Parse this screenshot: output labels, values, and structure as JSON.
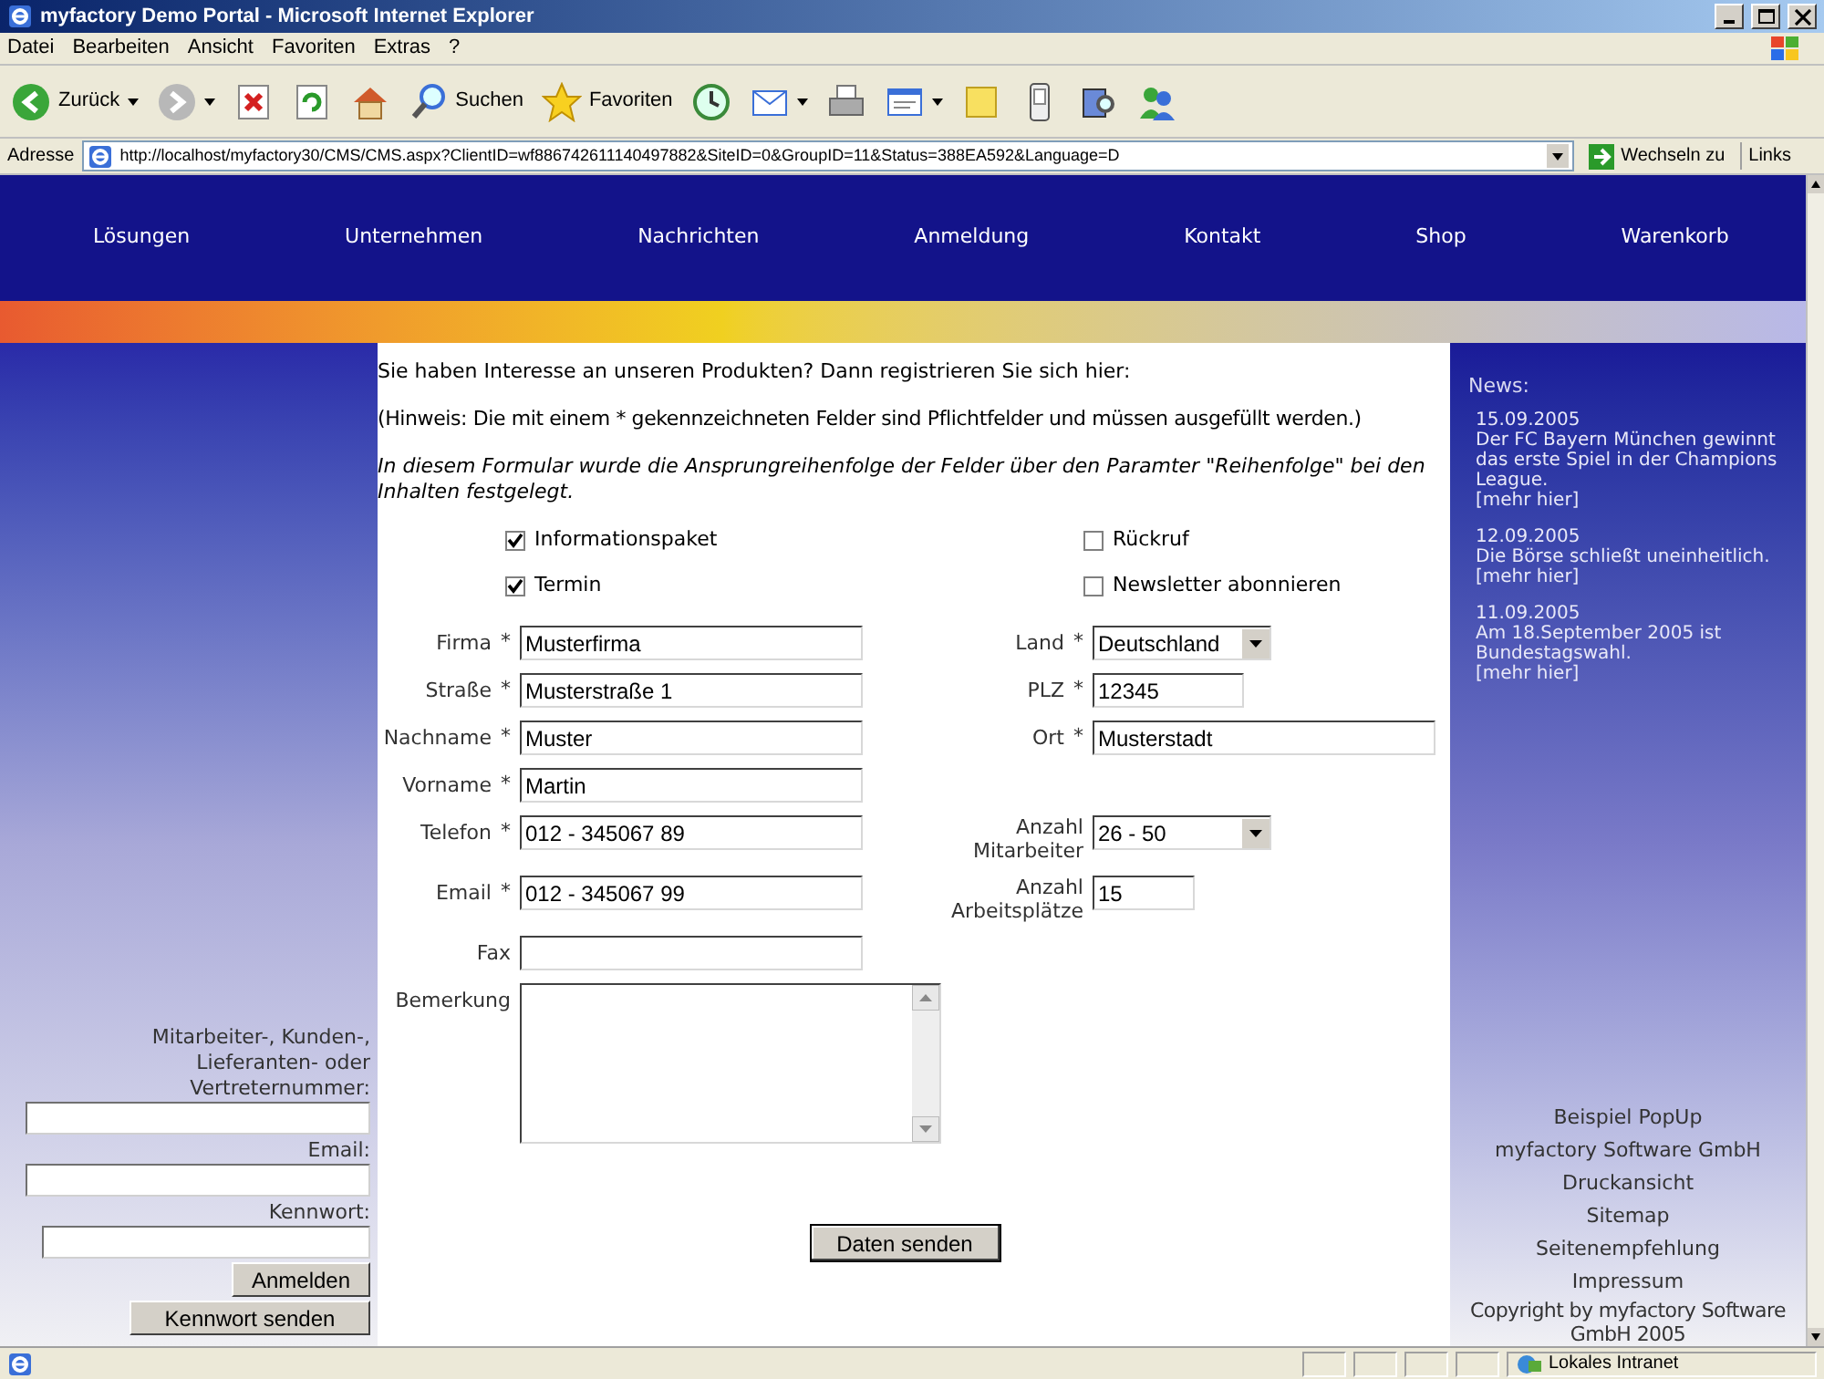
{
  "window": {
    "title": "myfactory Demo Portal - Microsoft Internet Explorer"
  },
  "menu": [
    "Datei",
    "Bearbeiten",
    "Ansicht",
    "Favoriten",
    "Extras",
    "?"
  ],
  "toolbar": [
    {
      "kind": "back",
      "label": "Zurück",
      "dropdown": true
    },
    {
      "kind": "forward",
      "dropdown": true
    },
    {
      "kind": "stop"
    },
    {
      "kind": "refresh"
    },
    {
      "kind": "home"
    },
    {
      "kind": "search",
      "label": "Suchen"
    },
    {
      "kind": "favorites",
      "label": "Favoriten"
    },
    {
      "kind": "history"
    },
    {
      "kind": "mail",
      "dropdown": true
    },
    {
      "kind": "print"
    },
    {
      "kind": "edit",
      "dropdown": true
    },
    {
      "kind": "note"
    },
    {
      "kind": "phone"
    },
    {
      "kind": "research"
    },
    {
      "kind": "messenger"
    }
  ],
  "address_bar": {
    "label": "Adresse",
    "url": "http://localhost/myfactory30/CMS/CMS.aspx?ClientID=wf886742611140497882&SiteID=0&GroupID=11&Status=388EA592&Language=D",
    "go": "Wechseln zu",
    "links": "Links"
  },
  "nav": [
    "Lösungen",
    "Unternehmen",
    "Nachrichten",
    "Anmeldung",
    "Kontakt",
    "Shop",
    "Warenkorb"
  ],
  "intro": "Sie haben Interesse an unseren Produkten? Dann registrieren Sie sich hier:",
  "hint": "(Hinweis: Die mit einem * gekennzeichneten Felder sind Pflichtfelder und müssen ausgefüllt werden.)",
  "note": "In diesem Formular wurde die Ansprungreihenfolge der Felder über den Paramter \"Reihenfolge\" bei den Inhalten festgelegt.",
  "checkboxes": [
    {
      "label": "Informationspaket",
      "checked": true
    },
    {
      "label": "Rückruf",
      "checked": false
    },
    {
      "label": "Termin",
      "checked": true
    },
    {
      "label": "Newsletter abonnieren",
      "checked": false
    }
  ],
  "form_rows": [
    {
      "left": {
        "label": "Firma",
        "asterisk": "*",
        "kind": "input",
        "value": "Musterfirma"
      },
      "right": {
        "label": "Land",
        "asterisk": "*",
        "kind": "select",
        "value": "Deutschland"
      }
    },
    {
      "left": {
        "label": "Straße",
        "asterisk": "*",
        "kind": "input",
        "value": "Musterstraße 1"
      },
      "right": {
        "label": "PLZ",
        "asterisk": "*",
        "kind": "input",
        "value": "12345"
      }
    },
    {
      "left": {
        "label": "Nachname",
        "asterisk": "*",
        "kind": "input",
        "value": "Muster"
      },
      "right": {
        "label": "Ort",
        "asterisk": "*",
        "kind": "input",
        "value": "Musterstadt"
      }
    },
    {
      "left": {
        "label": "Vorname",
        "asterisk": "*",
        "kind": "input",
        "value": "Martin"
      }
    },
    {
      "left": {
        "label": "Telefon",
        "asterisk": "*",
        "kind": "input",
        "value": "012 - 345067 89"
      },
      "right": {
        "label": "Anzahl Mitarbeiter",
        "kind": "select",
        "value": "26 - 50"
      }
    },
    {
      "left": {
        "label": "Email",
        "asterisk": "*",
        "kind": "input",
        "value": "012 - 345067 99"
      },
      "right": {
        "label": "Anzahl Arbeitsplätze",
        "kind": "input",
        "value": "15"
      }
    },
    {
      "left": {
        "label": "Fax",
        "kind": "input"
      }
    },
    {
      "left": {
        "label": "Bemerkung",
        "kind": "textarea"
      }
    }
  ],
  "submit": "Daten senden",
  "login": {
    "fields": [
      {
        "label": "Mitarbeiter-, Kunden-, Lieferanten- oder Vertreternummer:",
        "wide": true
      },
      {
        "label": "Email:",
        "wide": true
      },
      {
        "label": "Kennwort:",
        "wide": false
      }
    ],
    "buttons": [
      "Anmelden",
      "Kennwort senden"
    ]
  },
  "news": {
    "heading": "News:",
    "items": [
      {
        "date": "15.09.2005",
        "text": "Der FC Bayern München gewinnt das erste Spiel in der Champions League.",
        "link": "[mehr hier]"
      },
      {
        "date": "12.09.2005",
        "text": "Die Börse schließt uneinheitlich.",
        "link": "[mehr hier]"
      },
      {
        "date": "11.09.2005",
        "text": "Am 18.September 2005 ist Bundestagswahl.",
        "link": "[mehr hier]"
      }
    ]
  },
  "footer_links": [
    "Beispiel PopUp",
    "myfactory Software GmbH",
    "Druckansicht",
    "Sitemap",
    "Seitenempfehlung",
    "Impressum"
  ],
  "copyright": "Copyright by myfactory Software GmbH 2005",
  "status_bar": {
    "zone": "Lokales Intranet"
  }
}
